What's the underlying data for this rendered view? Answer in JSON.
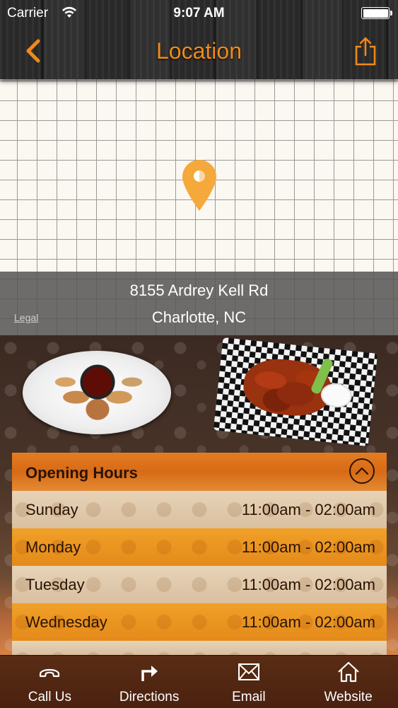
{
  "status_bar": {
    "carrier": "Carrier",
    "time": "9:07 AM"
  },
  "nav": {
    "title": "Location",
    "back_icon": "chevron-left-icon",
    "share_icon": "share-icon",
    "accent_color": "#f08a1c"
  },
  "map": {
    "address_line1": "8155 Ardrey Kell Rd",
    "address_line2": "Charlotte, NC",
    "legal_link": "Legal",
    "pin_color": "#f5a93a"
  },
  "hours": {
    "title": "Opening Hours",
    "days": [
      {
        "day": "Sunday",
        "time": "11:00am - 02:00am"
      },
      {
        "day": "Monday",
        "time": "11:00am - 02:00am"
      },
      {
        "day": "Tuesday",
        "time": "11:00am - 02:00am"
      },
      {
        "day": "Wednesday",
        "time": "11:00am - 02:00am"
      }
    ]
  },
  "tabbar": {
    "items": [
      {
        "label": "Call Us",
        "icon": "phone-icon"
      },
      {
        "label": "Directions",
        "icon": "directions-arrow-icon"
      },
      {
        "label": "Email",
        "icon": "envelope-icon"
      },
      {
        "label": "Website",
        "icon": "home-icon"
      }
    ]
  }
}
